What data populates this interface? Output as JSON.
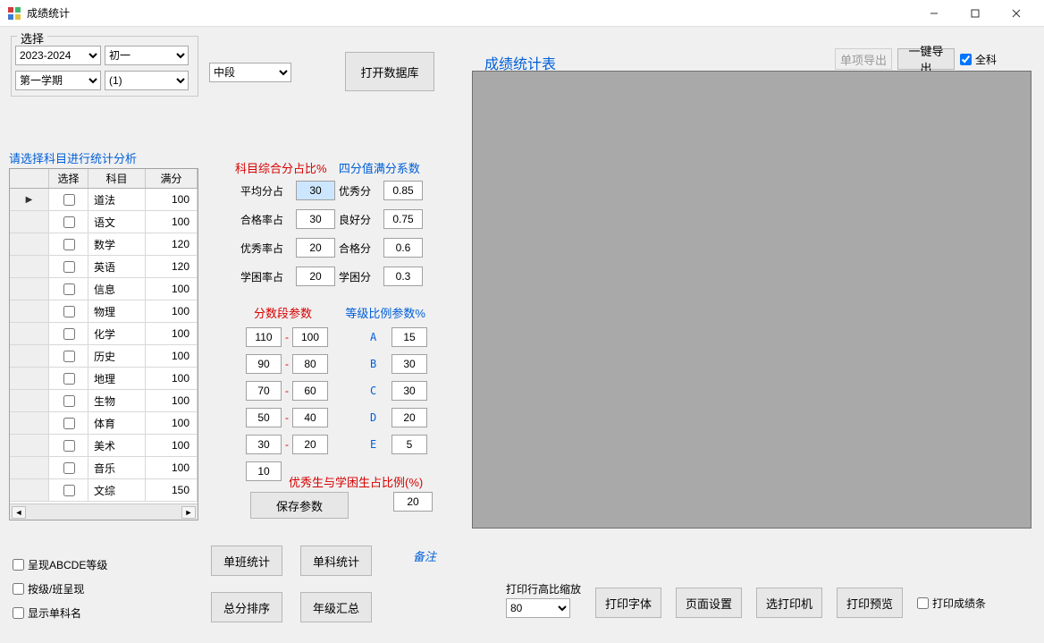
{
  "window": {
    "title": "成绩统计"
  },
  "select_group": {
    "title": "选择",
    "year": "2023-2024",
    "grade": "初一",
    "term": "第一学期",
    "klass": "(1)",
    "stage": "中段"
  },
  "open_db_button": "打开数据库",
  "subjects_prompt": "请选择科目进行统计分析",
  "grid": {
    "col_select": "选择",
    "col_subject": "科目",
    "col_full": "满分",
    "rows": [
      {
        "subject": "道法",
        "full": "100",
        "active": true
      },
      {
        "subject": "语文",
        "full": "100"
      },
      {
        "subject": "数学",
        "full": "120"
      },
      {
        "subject": "英语",
        "full": "120"
      },
      {
        "subject": "信息",
        "full": "100"
      },
      {
        "subject": "物理",
        "full": "100"
      },
      {
        "subject": "化学",
        "full": "100"
      },
      {
        "subject": "历史",
        "full": "100"
      },
      {
        "subject": "地理",
        "full": "100"
      },
      {
        "subject": "生物",
        "full": "100"
      },
      {
        "subject": "体育",
        "full": "100"
      },
      {
        "subject": "美术",
        "full": "100"
      },
      {
        "subject": "音乐",
        "full": "100"
      },
      {
        "subject": "文综",
        "full": "150"
      }
    ]
  },
  "params": {
    "ratio_header": "科目综合分占比%",
    "four_header": "四分值满分系数",
    "avg_label": "平均分占",
    "avg_val": "30",
    "excellent_full_label": "优秀分",
    "excellent_full_val": "0.85",
    "pass_rate_label": "合格率占",
    "pass_rate_val": "30",
    "good_full_label": "良好分",
    "good_full_val": "0.75",
    "excellent_rate_label": "优秀率占",
    "excellent_rate_val": "20",
    "pass_full_label": "合格分",
    "pass_full_val": "0.6",
    "struggle_rate_label": "学困率占",
    "struggle_rate_val": "20",
    "struggle_full_label": "学困分",
    "struggle_full_val": "0.3",
    "segment_header": "分数段参数",
    "grade_ratio_header": "等级比例参数%",
    "segments": [
      {
        "hi": "110",
        "lo": "100"
      },
      {
        "hi": "90",
        "lo": "80"
      },
      {
        "hi": "70",
        "lo": "60"
      },
      {
        "hi": "50",
        "lo": "40"
      },
      {
        "hi": "30",
        "lo": "20"
      },
      {
        "hi": "10",
        "lo": ""
      }
    ],
    "grade_letters": [
      "A",
      "B",
      "C",
      "D",
      "E"
    ],
    "grade_ratios": [
      "15",
      "30",
      "30",
      "20",
      "5"
    ],
    "top_strug_label": "优秀生与学困生占比例(%)",
    "top_strug_val": "20",
    "save_params_btn": "保存参数"
  },
  "results": {
    "title": "成绩统计表",
    "export_single": "单项导出",
    "export_all": "一键导出",
    "all_subjects_chk": "全科"
  },
  "left_checks": {
    "show_abcde": "呈现ABCDE等级",
    "by_class": "按级/班呈现",
    "show_single_subject": "显示单科名"
  },
  "action_buttons": {
    "class_stat": "单班统计",
    "subject_stat": "单科统计",
    "total_rank": "总分排序",
    "grade_summary": "年级汇总",
    "note": "备注"
  },
  "print_area": {
    "row_height_label": "打印行高比缩放",
    "row_height_val": "80",
    "font_btn": "打印字体",
    "page_btn": "页面设置",
    "printer_btn": "选打印机",
    "preview_btn": "打印预览",
    "print_slip_chk": "打印成绩条"
  }
}
